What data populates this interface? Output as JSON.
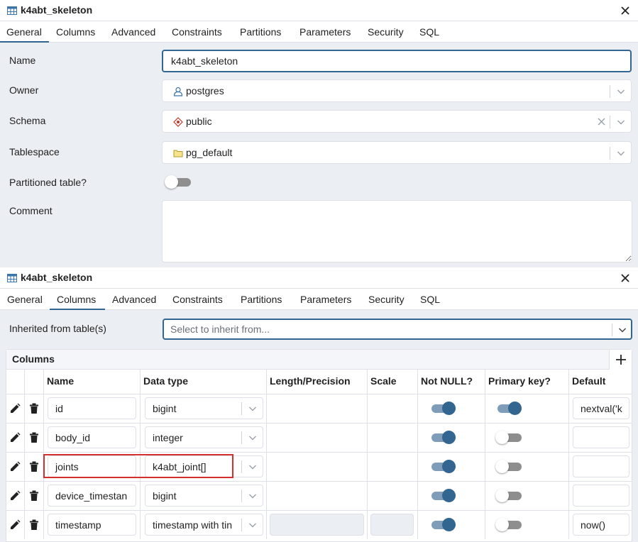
{
  "dialog1": {
    "title": "k4abt_skeleton",
    "tabs": [
      "General",
      "Columns",
      "Advanced",
      "Constraints",
      "Partitions",
      "Parameters",
      "Security",
      "SQL"
    ],
    "active_tab": "General",
    "fields": {
      "name_label": "Name",
      "name_value": "k4abt_skeleton",
      "owner_label": "Owner",
      "owner_value": "postgres",
      "schema_label": "Schema",
      "schema_value": "public",
      "tablespace_label": "Tablespace",
      "tablespace_value": "pg_default",
      "partitioned_label": "Partitioned table?",
      "partitioned_value": false,
      "comment_label": "Comment",
      "comment_value": ""
    }
  },
  "dialog2": {
    "title": "k4abt_skeleton",
    "tabs": [
      "General",
      "Columns",
      "Advanced",
      "Constraints",
      "Partitions",
      "Parameters",
      "Security",
      "SQL"
    ],
    "active_tab": "Columns",
    "inherit_label": "Inherited from table(s)",
    "inherit_placeholder": "Select to inherit from...",
    "columns_title": "Columns",
    "headers": [
      "Name",
      "Data type",
      "Length/Precision",
      "Scale",
      "Not NULL?",
      "Primary key?",
      "Default"
    ],
    "rows": [
      {
        "name": "id",
        "type": "bigint",
        "length": "",
        "scale": "",
        "not_null": true,
        "primary_key": true,
        "default": "nextval('k",
        "length_disabled": false
      },
      {
        "name": "body_id",
        "type": "integer",
        "length": "",
        "scale": "",
        "not_null": true,
        "primary_key": false,
        "default": "",
        "length_disabled": false
      },
      {
        "name": "joints",
        "type": "k4abt_joint[]",
        "length": "",
        "scale": "",
        "not_null": true,
        "primary_key": false,
        "default": "",
        "length_disabled": false
      },
      {
        "name": "device_timestan",
        "type": "bigint",
        "length": "",
        "scale": "",
        "not_null": true,
        "primary_key": false,
        "default": "",
        "length_disabled": false
      },
      {
        "name": "timestamp",
        "type": "timestamp with tin",
        "length": "",
        "scale": "",
        "not_null": true,
        "primary_key": false,
        "default": "now()",
        "length_disabled": true
      }
    ]
  },
  "colors": {
    "accent": "#326690",
    "highlight": "#d32f2f",
    "panel_bg": "#ebeef3"
  }
}
